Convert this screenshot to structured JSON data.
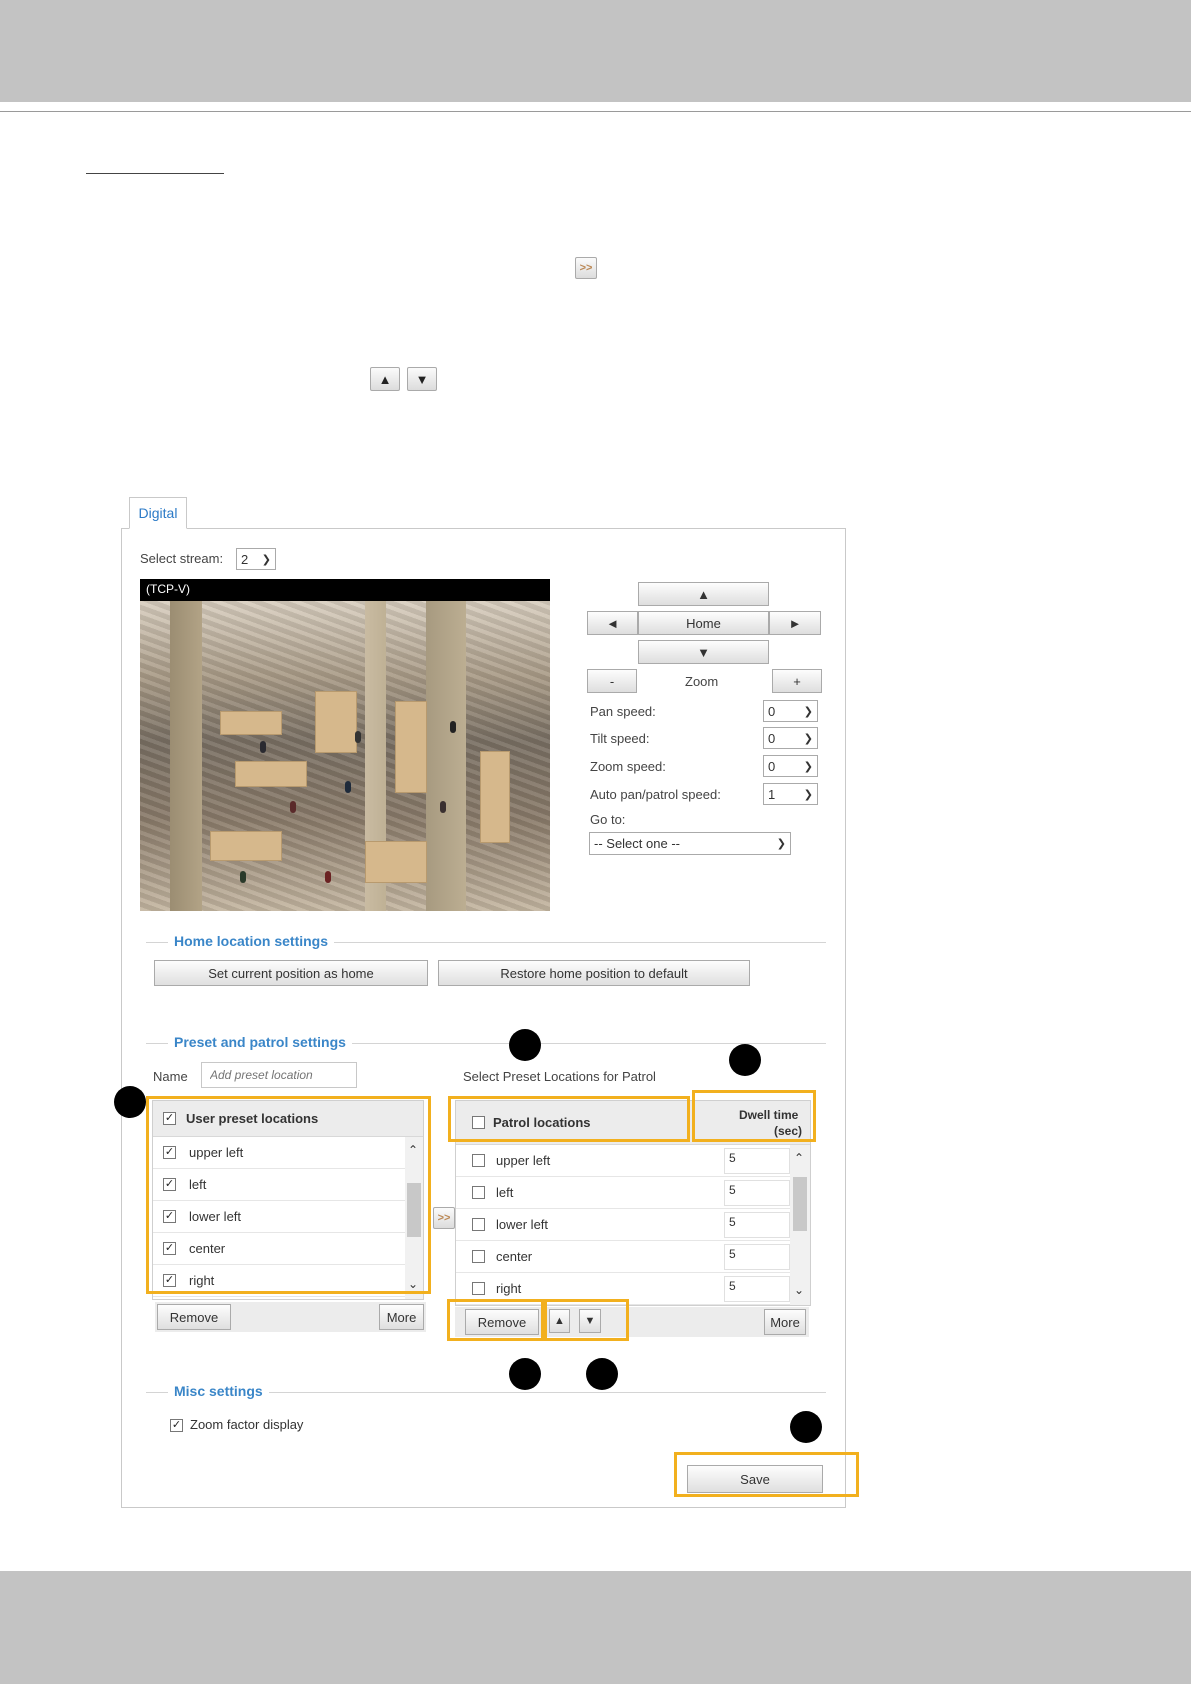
{
  "toolbar_icons": {
    "move_right_label": ">>",
    "up_label": "▲",
    "down_label": "▼"
  },
  "tab": {
    "label": "Digital"
  },
  "stream": {
    "label": "Select stream:",
    "value": "2"
  },
  "video": {
    "overlay_label": "(TCP-V)"
  },
  "ptz": {
    "up": "▲",
    "down": "▼",
    "left": "◄",
    "right": "►",
    "home": "Home",
    "zoom_minus": "-",
    "zoom_label": "Zoom",
    "zoom_plus": "+",
    "speeds": [
      {
        "label": "Pan speed:",
        "value": "0"
      },
      {
        "label": "Tilt speed:",
        "value": "0"
      },
      {
        "label": "Zoom speed:",
        "value": "0"
      },
      {
        "label": "Auto pan/patrol speed:",
        "value": "1"
      }
    ],
    "goto_label": "Go to:",
    "goto_value": "-- Select one --"
  },
  "home_settings": {
    "title": "Home location settings",
    "set_home": "Set current position as home",
    "restore_home": "Restore home position to default"
  },
  "preset": {
    "title": "Preset and patrol settings",
    "name_label": "Name",
    "name_placeholder": "Add preset location",
    "patrol_caption": "Select Preset Locations for Patrol",
    "user_header": "User preset locations",
    "patrol_header": "Patrol locations",
    "dwell_header_1": "Dwell time",
    "dwell_header_2": "(sec)",
    "user_items": [
      "upper left",
      "left",
      "lower left",
      "center",
      "right"
    ],
    "patrol_items": [
      {
        "name": "upper left",
        "dwell": "5"
      },
      {
        "name": "left",
        "dwell": "5"
      },
      {
        "name": "lower left",
        "dwell": "5"
      },
      {
        "name": "center",
        "dwell": "5"
      },
      {
        "name": "right",
        "dwell": "5"
      }
    ],
    "remove_label": "Remove",
    "more_label": "More",
    "transfer_label": ">>"
  },
  "misc": {
    "title": "Misc settings",
    "zoom_factor": "Zoom factor display"
  },
  "save_label": "Save",
  "colors": {
    "highlight": "#f2b01e",
    "accent": "#3a86c8"
  }
}
